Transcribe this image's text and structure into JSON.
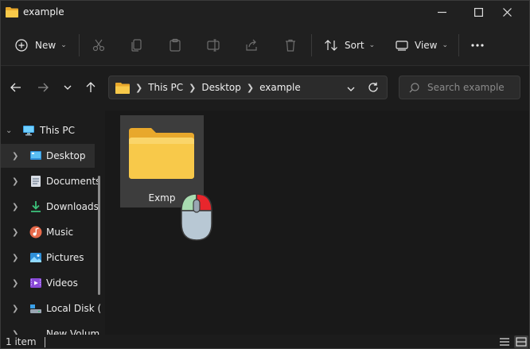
{
  "window": {
    "title": "example",
    "controls": [
      "minimize",
      "maximize",
      "close"
    ]
  },
  "toolbar": {
    "new_label": "New",
    "sort_label": "Sort",
    "view_label": "View",
    "icons": [
      "cut-icon",
      "copy-icon",
      "paste-icon",
      "rename-icon",
      "share-icon",
      "delete-icon",
      "more-icon"
    ]
  },
  "address": {
    "crumbs": [
      "This PC",
      "Desktop",
      "example"
    ]
  },
  "search": {
    "placeholder": "Search example"
  },
  "sidebar": {
    "root": "This PC",
    "items": [
      {
        "label": "Desktop",
        "icon": "desktop-icon"
      },
      {
        "label": "Documents",
        "icon": "documents-icon"
      },
      {
        "label": "Downloads",
        "icon": "downloads-icon"
      },
      {
        "label": "Music",
        "icon": "music-icon"
      },
      {
        "label": "Pictures",
        "icon": "pictures-icon"
      },
      {
        "label": "Videos",
        "icon": "videos-icon"
      },
      {
        "label": "Local Disk (",
        "icon": "drive-icon"
      },
      {
        "label": "New Volum",
        "icon": "drive-icon"
      }
    ],
    "selected": "Desktop"
  },
  "content": {
    "items": [
      {
        "name": "Exmp",
        "type": "folder",
        "selected": true
      }
    ]
  },
  "status": {
    "count": "1 item"
  },
  "colors": {
    "folder_yellow": "#f8c94a",
    "accent_blue": "#60cdff",
    "mouse_left": "#a8dcb0",
    "mouse_right": "#e8262c"
  }
}
